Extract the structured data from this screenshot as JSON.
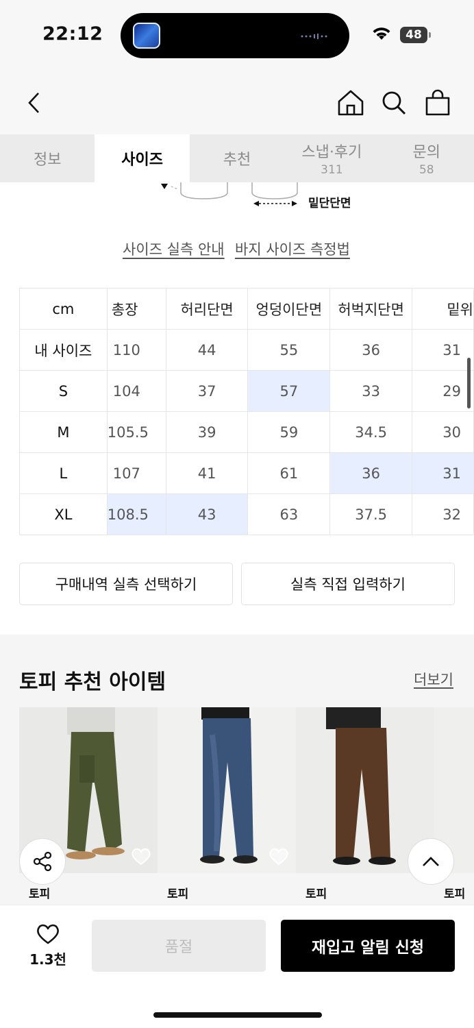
{
  "status_bar": {
    "time": "22:12",
    "battery": "48"
  },
  "nav": {
    "back": "back-icon",
    "home": "home-icon",
    "search": "search-icon",
    "cart": "shopping-bag-icon"
  },
  "tabs": [
    {
      "label": "정보",
      "count": ""
    },
    {
      "label": "사이즈",
      "count": ""
    },
    {
      "label": "추천",
      "count": ""
    },
    {
      "label": "스냅·후기",
      "count": "311"
    },
    {
      "label": "문의",
      "count": "58"
    }
  ],
  "diagram": {
    "hem_label": "밑단단면"
  },
  "guide_links": {
    "size_guide": "사이즈 실측 안내",
    "measure_guide": "바지 사이즈 측정법"
  },
  "size_table": {
    "unit": "cm",
    "columns": [
      "총장",
      "허리단면",
      "엉덩이단면",
      "허벅지단면",
      "밑위"
    ],
    "rows": [
      {
        "label": "내 사이즈",
        "values": [
          "110",
          "44",
          "55",
          "36",
          "31"
        ]
      },
      {
        "label": "S",
        "values": [
          "104",
          "37",
          "57",
          "33",
          "29"
        ]
      },
      {
        "label": "M",
        "values": [
          "105.5",
          "39",
          "59",
          "34.5",
          "30"
        ]
      },
      {
        "label": "L",
        "values": [
          "107",
          "41",
          "61",
          "36",
          "31"
        ]
      },
      {
        "label": "XL",
        "values": [
          "108.5",
          "43",
          "63",
          "37.5",
          "32"
        ]
      }
    ]
  },
  "actions": {
    "select_purchase": "구매내역 실측 선택하기",
    "manual_input": "실측 직접 입력하기"
  },
  "recommend": {
    "title": "토피 추천 아이템",
    "more": "더보기",
    "items": [
      {
        "brand": "토피"
      },
      {
        "brand": "토피"
      },
      {
        "brand": "토피"
      },
      {
        "brand": "토피"
      }
    ]
  },
  "bottom_bar": {
    "likes": "1.3천",
    "soldout": "품절",
    "restock": "재입고 알림 신청"
  }
}
